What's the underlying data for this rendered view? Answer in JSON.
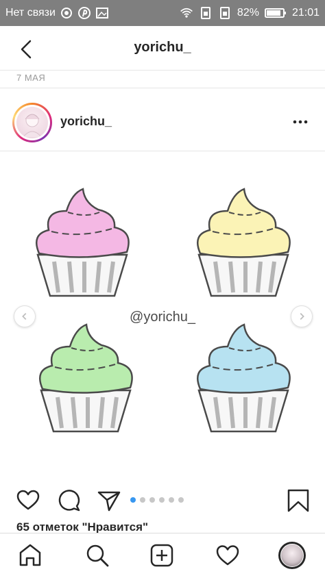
{
  "status_bar": {
    "carrier": "Нет связи",
    "battery": "82%",
    "time": "21:01",
    "icons": [
      "notification-icon",
      "pinterest-icon",
      "gallery-icon",
      "wifi-icon",
      "sim-icon",
      "sim-icon",
      "battery-icon"
    ]
  },
  "header": {
    "back_icon": "back-arrow-icon",
    "title": "yorichu_"
  },
  "post": {
    "date": "7 МАЯ",
    "username": "yorichu_",
    "more_icon": "more-options-icon",
    "watermark": "@yorichu_",
    "carousel": {
      "total": 6,
      "current": 1
    },
    "cupcake_colors": [
      "#f4b8e4",
      "#fbf3b6",
      "#b9ecae",
      "#b7e2f1"
    ],
    "likes": "65 отметок \"Нравится\""
  },
  "actions": {
    "icons": [
      "like-heart-icon",
      "comment-icon",
      "share-icon",
      "save-bookmark-icon"
    ]
  },
  "bottom_nav": {
    "icons": [
      "home-icon",
      "search-icon",
      "add-post-icon",
      "activity-heart-icon",
      "profile-avatar"
    ]
  },
  "colors": {
    "status_bar_bg": "#7f7f7f",
    "accent_blue": "#3897f0",
    "text_primary": "#262626",
    "text_secondary": "#999999"
  }
}
